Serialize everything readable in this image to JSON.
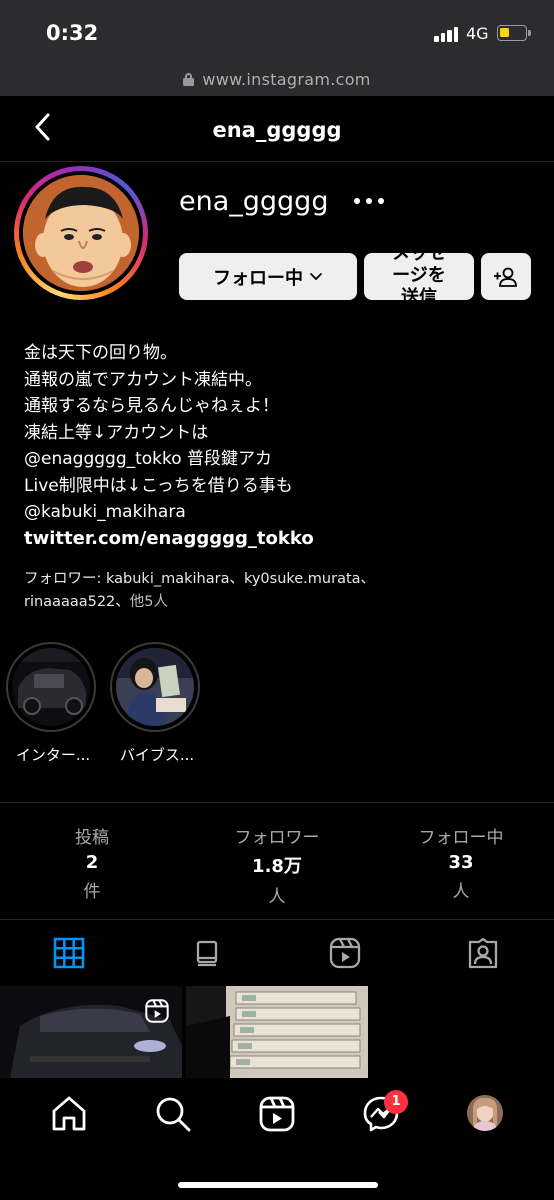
{
  "status_bar": {
    "time": "0:32",
    "network": "4G",
    "battery_level": 0.3
  },
  "browser": {
    "url": "www.instagram.com"
  },
  "header": {
    "title": "ena_ggggg",
    "back_icon": "chevron-left-icon"
  },
  "profile": {
    "username": "ena_ggggg",
    "more_icon": "ellipsis-icon",
    "follow_button": "フォロー中",
    "message_button_line1": "メッセ",
    "message_button_line2": "ージを",
    "message_button_line3": "送信",
    "add_user_icon": "add-user-icon"
  },
  "bio": {
    "lines": [
      "金は天下の回り物。",
      "通報の嵐でアカウント凍結中。",
      "通報するなら見るんじゃねぇよ！",
      "凍結上等↓アカウントは",
      "@enaggggg_tokko 普段鍵アカ",
      "Live制限中は↓こっちを借りる事も",
      "@kabuki_makihara"
    ],
    "link": "twitter.com/enaggggg_tokko"
  },
  "followed_by": {
    "prefix": "フォロワー: ",
    "names": "kabuki_makihara、ky0suke.murata、",
    "names2": "rinaaaaa522、",
    "others": "他5人"
  },
  "highlights": [
    {
      "label": "インター..."
    },
    {
      "label": "バイブス..."
    }
  ],
  "stats": {
    "posts": {
      "label": "投稿",
      "value": "2",
      "unit": "件"
    },
    "followers": {
      "label": "フォロワー",
      "value": "1.8万",
      "unit": "人"
    },
    "following": {
      "label": "フォロー中",
      "value": "33",
      "unit": "人"
    }
  },
  "tabs": [
    {
      "icon": "grid-icon",
      "active": true
    },
    {
      "icon": "igtv-icon",
      "active": false
    },
    {
      "icon": "reels-icon",
      "active": false
    },
    {
      "icon": "tagged-icon",
      "active": false
    }
  ],
  "bottom_nav": {
    "items": [
      "home-icon",
      "search-icon",
      "reels-icon",
      "messenger-icon",
      "profile-avatar"
    ],
    "messenger_badge": "1"
  },
  "colors": {
    "accent": "#0095f6",
    "badge": "#ff3040",
    "battery": "#ffd60a"
  }
}
